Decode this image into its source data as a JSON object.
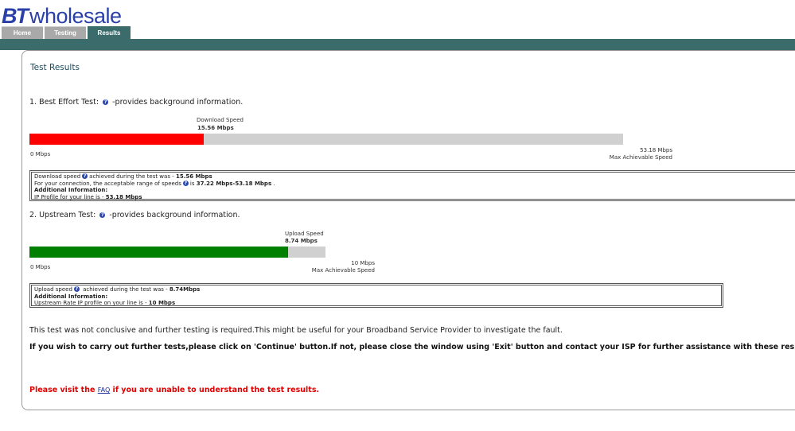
{
  "header": {
    "logo_bt": "BT",
    "logo_word": "wholesale",
    "tabs": [
      "Home",
      "Testing",
      "Results"
    ]
  },
  "main": {
    "title": "Test Results",
    "download": {
      "heading_prefix": "1. Best Effort Test:",
      "heading_suffix": "-provides background information.",
      "label": "Download Speed",
      "value": "15.56 Mbps",
      "min_label": "0 Mbps",
      "max_value": "53.18 Mbps",
      "max_label": "Max Achievable Speed",
      "fill_fraction": 0.293,
      "fill_color": "#ff0000",
      "info": {
        "line1_a": "Download speed",
        "line1_b": "achieved during the test was - ",
        "line1_v": "15.56 Mbps",
        "line2_a": "For your connection, the acceptable range of speeds",
        "line2_b": "is ",
        "line2_v": "37.22 Mbps-53.18 Mbps",
        "line2_c": " .",
        "line3": "Additional Information:",
        "line4_a": "IP Profile for your line is - ",
        "line4_v": "53.18 Mbps"
      }
    },
    "upload": {
      "heading_prefix": "2. Upstream Test:",
      "heading_suffix": "-provides background information.",
      "label": "Upload Speed",
      "value": "8.74 Mbps",
      "min_label": "0 Mbps",
      "max_value": "10 Mbps",
      "max_label": "Max Achievable Speed",
      "fill_fraction": 0.874,
      "fill_color": "#008000",
      "info": {
        "line1_a": "Upload speed",
        "line1_b": " achieved during the test was - ",
        "line1_v": "8.74Mbps",
        "line2": "Additional Information:",
        "line3_a": "Upstream Rate IP profile on your line is - ",
        "line3_v": "10 Mbps"
      }
    },
    "note": "This test was not conclusive and further testing is required.This might be useful for your Broadband Service Provider to investigate the fault.",
    "instruction": "If you wish to carry out further tests,please click on 'Continue' button.If not, please close the window using 'Exit' button and contact your ISP for further assistance with these results.",
    "faq_prefix": "Please visit the ",
    "faq_link": "FAQ",
    "faq_suffix": " if you are unable to understand the test results."
  },
  "colors": {
    "brand_blue": "#2a3fa8",
    "teal": "#3b6b6b",
    "download_fill": "#ff0000",
    "upload_fill": "#008000",
    "faq_red": "#e00000"
  },
  "icons": [
    "help-icon"
  ]
}
